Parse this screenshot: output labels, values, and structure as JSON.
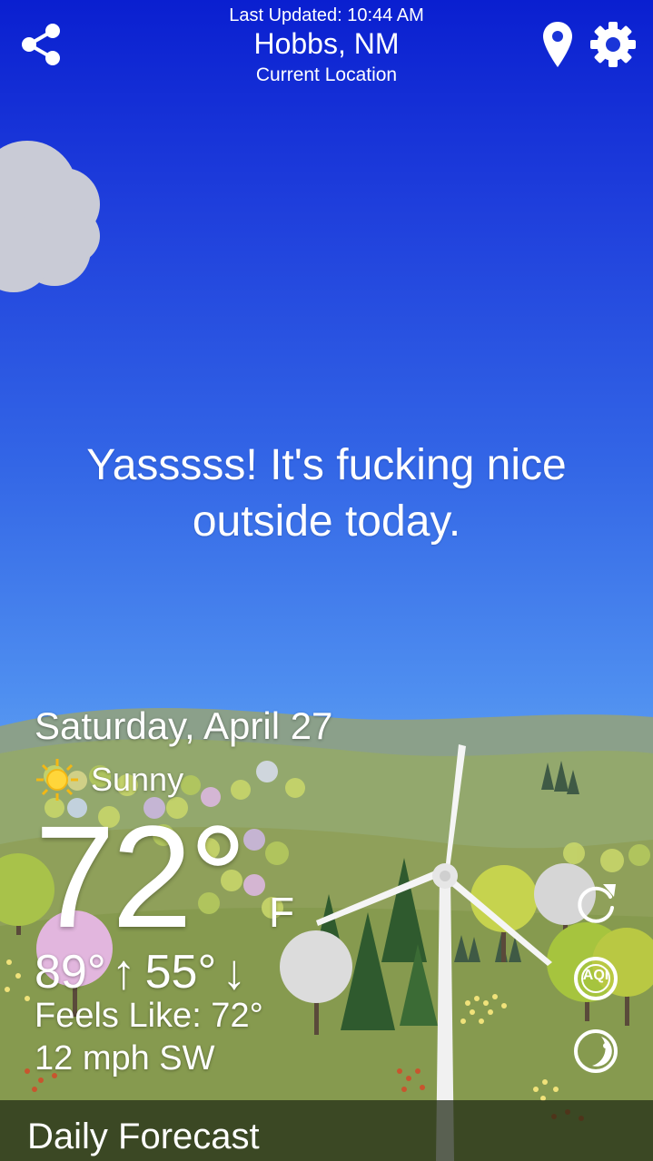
{
  "header": {
    "last_updated": "Last Updated: 10:44 AM",
    "city": "Hobbs, NM",
    "location_label": "Current Location",
    "share_icon": "share-icon",
    "location_icon": "map-pin-icon",
    "settings_icon": "gear-icon"
  },
  "message": "Yasssss! It's fucking nice outside today.",
  "weather": {
    "date": "Saturday, April 27",
    "condition": "Sunny",
    "condition_icon": "sun-icon",
    "temperature": "72°",
    "unit": "F",
    "high": "89°",
    "low": "55°",
    "feels_like": "Feels Like: 72°",
    "wind": "12 mph SW"
  },
  "side_buttons": {
    "refresh_icon": "refresh-icon",
    "aqi_label": "AQI",
    "moon_icon": "moon-icon"
  },
  "forecast": {
    "title": "Daily Forecast"
  },
  "colors": {
    "sky_top": "#0a1fd0",
    "sky_bottom": "#8fc2f0",
    "hill": "#8fa05a",
    "forecast_bar": "#2a3320"
  }
}
